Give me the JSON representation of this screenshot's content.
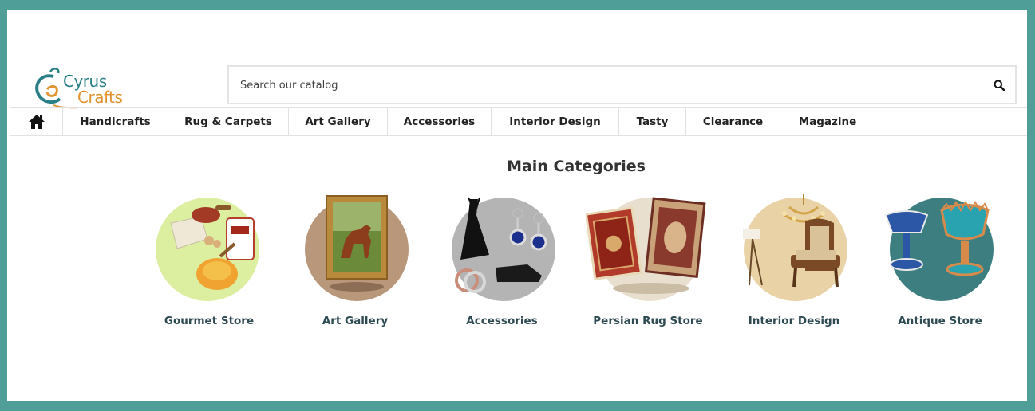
{
  "brand": {
    "line1": "Cyrus",
    "line2": "Crafts"
  },
  "search": {
    "placeholder": "Search our catalog",
    "icon": "search-icon"
  },
  "nav": {
    "home_icon": "home-icon",
    "items": [
      {
        "label": "Handicrafts"
      },
      {
        "label": "Rug & Carpets"
      },
      {
        "label": "Art Gallery"
      },
      {
        "label": "Accessories"
      },
      {
        "label": "Interior Design"
      },
      {
        "label": "Tasty"
      },
      {
        "label": "Clearance"
      },
      {
        "label": "Magazine"
      }
    ]
  },
  "main": {
    "title": "Main Categories",
    "categories": [
      {
        "label": "Gourmet Store",
        "bg": "#dcefa0"
      },
      {
        "label": "Art Gallery",
        "bg": "#b9977a"
      },
      {
        "label": "Accessories",
        "bg": "#b4b4b4"
      },
      {
        "label": "Persian Rug Store",
        "bg": "#e9dfcf"
      },
      {
        "label": "Interior Design",
        "bg": "#e8d2a6"
      },
      {
        "label": "Antique Store",
        "bg": "#3d7f80"
      }
    ]
  },
  "colors": {
    "frame": "#4f9e97",
    "brand_teal": "#2a7f86",
    "brand_orange": "#e0932e"
  }
}
